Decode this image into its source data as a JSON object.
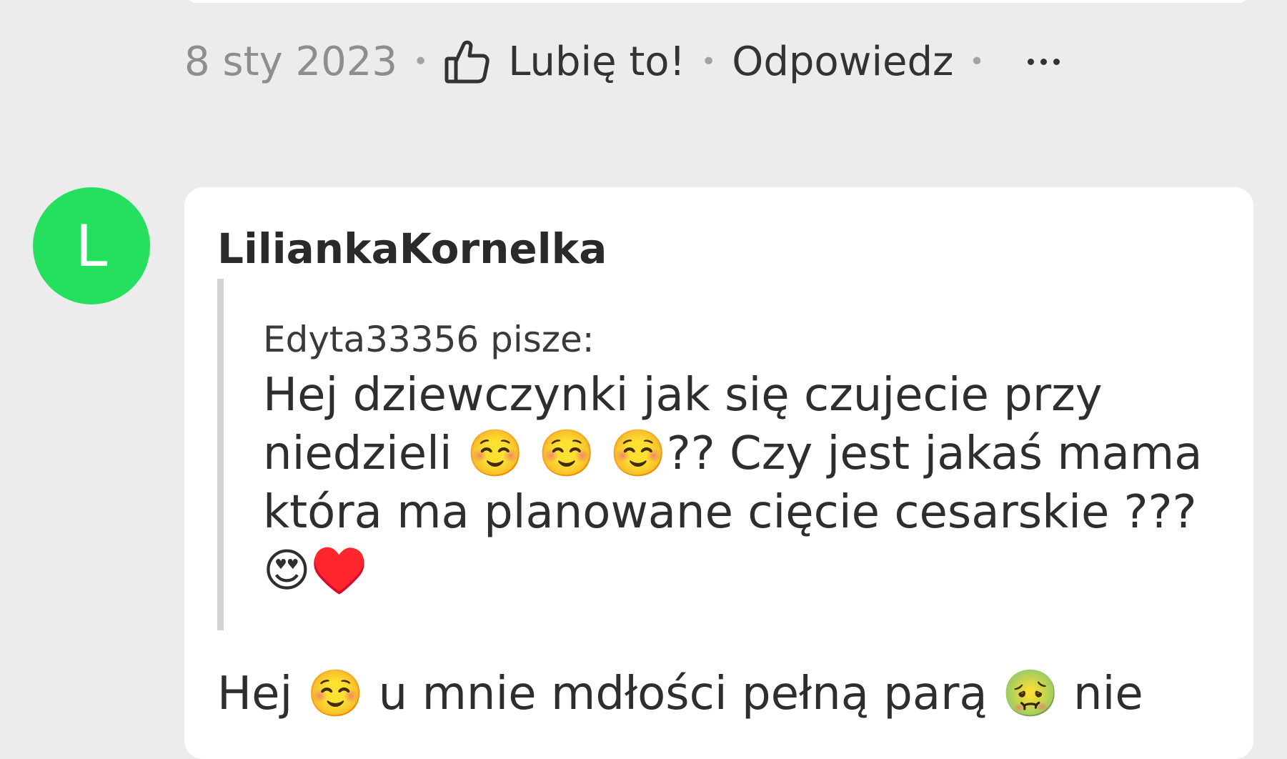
{
  "previous_comment": {
    "date": "8 sty 2023",
    "like_label": "Lubię to!",
    "reply_label": "Odpowiedz",
    "separator": "•",
    "more_icon": "more-horizontal-icon",
    "like_icon": "thumbs-up-icon"
  },
  "comment": {
    "avatar_letter": "L",
    "avatar_color": "#25df5f",
    "author": "LiliankaKornelka",
    "quote": {
      "author_line": "Edyta33356 pisze:",
      "text": "Hej dziewczynki jak się czujecie przy niedzieli ☺️ ☺️ ☺️?? Czy jest jakaś mama która ma planowane cięcie cesarskie ??? 😍♥️"
    },
    "reply_text": "Hej ☺️ u mnie mdłości pełną parą 🤢 nie"
  }
}
